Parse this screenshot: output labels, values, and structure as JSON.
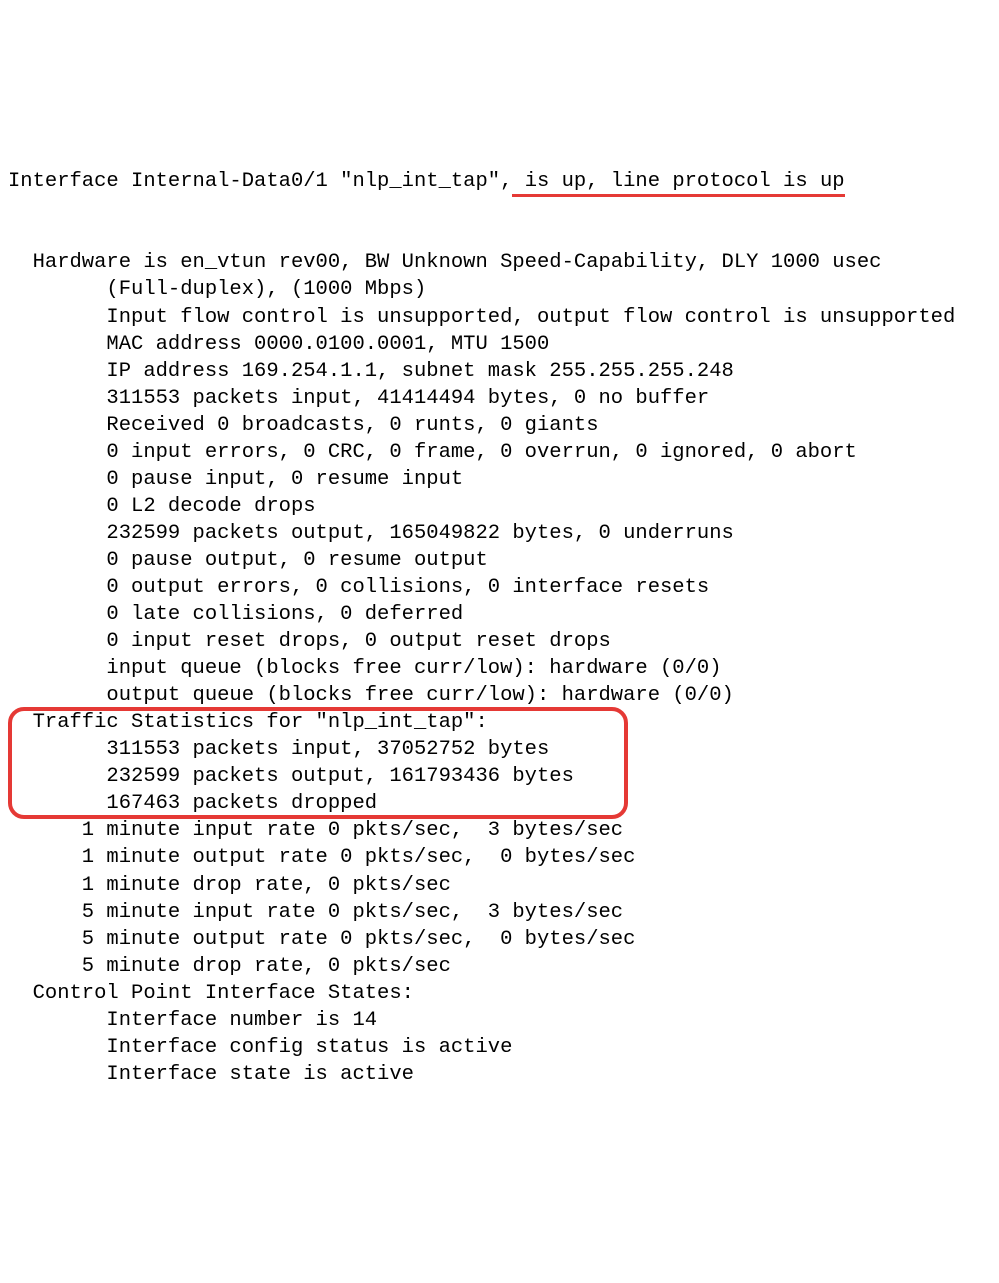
{
  "interface": {
    "header_prefix": "Interface Internal-Data0/1 \"nlp_int_tap\",",
    "header_status": " is up, line protocol is up",
    "lines": [
      "  Hardware is en_vtun rev00, BW Unknown Speed-Capability, DLY 1000 usec",
      "        (Full-duplex), (1000 Mbps)",
      "        Input flow control is unsupported, output flow control is unsupported",
      "        MAC address 0000.0100.0001, MTU 1500",
      "        IP address 169.254.1.1, subnet mask 255.255.255.248",
      "        311553 packets input, 41414494 bytes, 0 no buffer",
      "        Received 0 broadcasts, 0 runts, 0 giants",
      "        0 input errors, 0 CRC, 0 frame, 0 overrun, 0 ignored, 0 abort",
      "        0 pause input, 0 resume input",
      "        0 L2 decode drops",
      "        232599 packets output, 165049822 bytes, 0 underruns",
      "        0 pause output, 0 resume output",
      "        0 output errors, 0 collisions, 0 interface resets",
      "        0 late collisions, 0 deferred",
      "        0 input reset drops, 0 output reset drops",
      "        input queue (blocks free curr/low): hardware (0/0)",
      "        output queue (blocks free curr/low): hardware (0/0)"
    ],
    "traffic_stats": [
      "  Traffic Statistics for \"nlp_int_tap\":",
      "        311553 packets input, 37052752 bytes",
      "        232599 packets output, 161793436 bytes",
      "        167463 packets dropped"
    ],
    "rates": [
      "      1 minute input rate 0 pkts/sec,  3 bytes/sec",
      "      1 minute output rate 0 pkts/sec,  0 bytes/sec",
      "      1 minute drop rate, 0 pkts/sec",
      "      5 minute input rate 0 pkts/sec,  3 bytes/sec",
      "      5 minute output rate 0 pkts/sec,  0 bytes/sec",
      "      5 minute drop rate, 0 pkts/sec"
    ],
    "control_point": [
      "  Control Point Interface States:",
      "        Interface number is 14",
      "        Interface config status is active",
      "        Interface state is active"
    ]
  },
  "annotations": {
    "underline_target": "header_status",
    "box_start_index": 18,
    "box_end_index": 21
  }
}
